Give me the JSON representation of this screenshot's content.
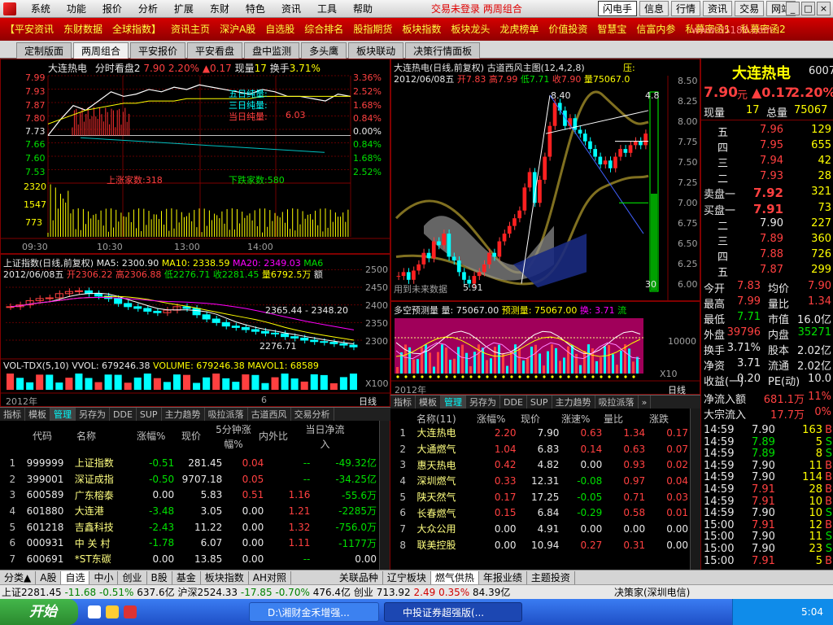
{
  "menu": {
    "items": [
      "系统",
      "功能",
      "报价",
      "分析",
      "扩展",
      "东财",
      "特色",
      "资讯",
      "工具",
      "帮助"
    ],
    "center": "交易未登录    两周组合"
  },
  "toolbar": {
    "items": [
      "闪电手",
      "信息",
      "行情",
      "资讯",
      "交易",
      "网站"
    ]
  },
  "redbar": {
    "items": [
      "【平安资讯",
      "东财数据",
      "全球指数】",
      "资讯主页",
      "深沪A股",
      "自选股",
      "综合排名",
      "股指期货",
      "板块指数",
      "板块龙头",
      "龙虎榜单",
      "价值投资",
      "智慧宝",
      "信富内参",
      "私募密函1",
      "私募密函2"
    ]
  },
  "tabs": {
    "items": [
      "定制版面",
      "两周组合",
      "平安报价",
      "平安看盘",
      "盘中监测",
      "多头鹰",
      "板块联动",
      "决策行情面板"
    ],
    "active": 1
  },
  "intraday": {
    "title": "大连热电",
    "mode": "分时看盘2",
    "price": "7.90",
    "pct": "2.20%",
    "chg": "▲0.17",
    "vol_label": "现量",
    "vol": "17",
    "turnover_label": "换手",
    "turnover": "3.71%",
    "left_axis": [
      "7.99",
      "7.93",
      "7.87",
      "7.80",
      "7.73",
      "7.66",
      "7.60",
      "7.53",
      "2320",
      "1547",
      "773"
    ],
    "right_axis": [
      "3.36%",
      "2.52%",
      "1.68%",
      "0.84%",
      "0.00%",
      "0.84%",
      "1.68%",
      "2.52%"
    ],
    "times": [
      "09:30",
      "10:30",
      "13:00",
      "14:00"
    ],
    "legend": [
      "五日纯量:",
      "三日纯量:",
      "当日纯量:"
    ],
    "legend_val": "6.03",
    "up_count": "上涨家数:318",
    "down_count": "下跌家数:580",
    "price_line": [
      7.73,
      7.8,
      7.86,
      7.84,
      7.88,
      7.92,
      7.9,
      7.91,
      7.93,
      7.92,
      7.94,
      7.93,
      7.95,
      7.94,
      7.93,
      7.92,
      7.91,
      7.93,
      7.92,
      7.9,
      7.9,
      7.89,
      7.88,
      7.91,
      7.9
    ],
    "avg_line": [
      7.78,
      7.8,
      7.82,
      7.84,
      7.85,
      7.86,
      7.87,
      7.87,
      7.88,
      7.88,
      7.88,
      7.89,
      7.89,
      7.89,
      7.89,
      7.89,
      7.89,
      7.9,
      7.9,
      7.9,
      7.9,
      7.9,
      7.9,
      7.9,
      7.9
    ]
  },
  "index": {
    "title": "上证指数(日线,前复权)",
    "ma5": "MA5: 2300.90",
    "ma10": "MA10: 2338.59",
    "ma20": "MA20: 2349.03",
    "ma6": "MA6",
    "date": "2012/06/08五",
    "open": "开2306.22",
    "high": "高2306.88",
    "low": "低2276.71",
    "close": "收2281.45",
    "amount": "量6792.5万",
    "amount_unit": "额",
    "axis": [
      "2500",
      "2450",
      "2400",
      "2350",
      "2300"
    ],
    "ann_high": "2365.44 - 2348.20",
    "ann_low": "2276.71",
    "closes": [
      2395,
      2400,
      2412,
      2418,
      2420,
      2432,
      2438,
      2440,
      2432,
      2425,
      2418,
      2404,
      2395,
      2390,
      2382,
      2378,
      2385,
      2395,
      2390,
      2372,
      2360,
      2350,
      2340,
      2336,
      2330,
      2325,
      2320,
      2318,
      2310,
      2306,
      2300,
      2296,
      2294,
      2290,
      2286,
      2281
    ]
  },
  "vol": {
    "title": "VOL-TDX(5,10)",
    "vvol": "VVOL: 679246.38",
    "volume": "VOLUME: 679246.38",
    "mavol": "MAVOL1: 68589",
    "unit": "X100",
    "year": "2012年",
    "month": "6",
    "period": "日线"
  },
  "kline": {
    "title": "大连热电(日线,前复权) 古道西风主图(12,4,2,8)",
    "extra": "压:",
    "date": "2012/06/08五",
    "open": "开7.83",
    "high": "高7.99",
    "low": "低7.71",
    "close": "收7.90",
    "amount": "量75067.0",
    "axis": [
      "8.50",
      "8.25",
      "8.00",
      "7.75",
      "7.50",
      "7.25",
      "7.00",
      "6.75",
      "6.50",
      "6.25",
      "6.00"
    ],
    "ann_high": "8.40",
    "ann_low": "5.91",
    "ann_right": "4.8",
    "ann_bottom": "30",
    "note": "用到未来数据",
    "closes": [
      6.05,
      6.1,
      6.0,
      6.12,
      6.2,
      6.35,
      6.28,
      6.5,
      6.45,
      6.6,
      6.3,
      6.25,
      6.1,
      6.0,
      5.95,
      6.05,
      6.1,
      6.2,
      6.35,
      6.3,
      6.5,
      6.6,
      6.7,
      6.8,
      6.9,
      7.2,
      7.4,
      7.0,
      7.3,
      7.6,
      8.0,
      8.3,
      8.2,
      8.0,
      8.1,
      7.95,
      7.9,
      7.8,
      7.7,
      7.6,
      7.5,
      7.55,
      7.45,
      7.6,
      7.7,
      7.65,
      7.75,
      7.8,
      7.75,
      7.9
    ]
  },
  "forecast": {
    "title": "多空预测量",
    "amount": "量: 75067.00",
    "pred": "预测量: 75067.00",
    "turnover": "换: 3.71",
    "flow": "流",
    "axis": "10000",
    "unit": "X10",
    "year": "2012年",
    "period": "日线"
  },
  "left_list": {
    "tabs": [
      "指标",
      "模板",
      "管理",
      "另存为",
      "DDE",
      "SUP",
      "主力趋势",
      "吸拉派落",
      "古道西风",
      "交易分析"
    ],
    "active": 2,
    "headers": [
      "代码",
      "名称",
      "涨幅%",
      "现价",
      "5分钟涨幅%",
      "内外比",
      "当日净流入"
    ],
    "rows": [
      [
        "1",
        "999999",
        "上证指数",
        "-0.51",
        "281.45",
        "0.04",
        "--",
        "-49.32亿"
      ],
      [
        "2",
        "399001",
        "深证成指",
        "-0.50",
        "9707.18",
        "0.05",
        "--",
        "-34.25亿"
      ],
      [
        "3",
        "600589",
        "广东榕泰",
        "0.00",
        "5.83",
        "0.51",
        "1.16",
        "-55.6万"
      ],
      [
        "4",
        "601880",
        "大连港",
        "-3.48",
        "3.05",
        "0.00",
        "1.21",
        "-2285万"
      ],
      [
        "5",
        "601218",
        "吉鑫科技",
        "-2.43",
        "11.22",
        "0.00",
        "1.32",
        "-756.0万"
      ],
      [
        "6",
        "000931",
        "中 关 村",
        "-1.78",
        "6.07",
        "0.00",
        "1.11",
        "-1177万"
      ],
      [
        "7",
        "600691",
        "*ST东碳",
        "0.00",
        "13.85",
        "0.00",
        "--",
        "0.00"
      ]
    ]
  },
  "right_list": {
    "tabs": [
      "指标",
      "模板",
      "管理",
      "另存为",
      "DDE",
      "SUP",
      "主力趋势",
      "吸拉派落"
    ],
    "active": 2,
    "headers": [
      "名称(11)",
      "涨幅%",
      "现价",
      "涨速%",
      "量比",
      "涨跌"
    ],
    "rows": [
      [
        "1",
        "大连热电",
        "2.20",
        "7.90",
        "0.63",
        "1.34",
        "0.17"
      ],
      [
        "2",
        "大通燃气",
        "1.04",
        "6.83",
        "0.14",
        "0.63",
        "0.07"
      ],
      [
        "3",
        "惠天热电",
        "0.42",
        "4.82",
        "0.00",
        "0.93",
        "0.02"
      ],
      [
        "4",
        "深圳燃气",
        "0.33",
        "12.31",
        "-0.08",
        "0.97",
        "0.04"
      ],
      [
        "5",
        "陕天然气",
        "0.17",
        "17.25",
        "-0.05",
        "0.71",
        "0.03"
      ],
      [
        "6",
        "长春燃气",
        "0.15",
        "6.84",
        "-0.29",
        "0.58",
        "0.01"
      ],
      [
        "7",
        "大众公用",
        "0.00",
        "4.91",
        "0.00",
        "0.00",
        "0.00"
      ],
      [
        "8",
        "联美控股",
        "0.00",
        "10.94",
        "0.27",
        "0.31",
        "0.00"
      ]
    ]
  },
  "quote": {
    "name": "大连热电",
    "code": "6007",
    "price": "7.90",
    "price_unit": "元",
    "chg": "▲0.17",
    "pct": "2.20%",
    "now_label": "现量",
    "now": "17",
    "total_label": "总量",
    "total": "75067",
    "sells": [
      [
        "五",
        "7.96",
        "129"
      ],
      [
        "四",
        "7.95",
        "655"
      ],
      [
        "三",
        "7.94",
        "42"
      ],
      [
        "二",
        "7.93",
        "28"
      ],
      [
        "卖盘一",
        "7.92",
        "321"
      ]
    ],
    "buys": [
      [
        "买盘一",
        "7.91",
        "73"
      ],
      [
        "二",
        "7.90",
        "227"
      ],
      [
        "三",
        "7.89",
        "360"
      ],
      [
        "四",
        "7.88",
        "726"
      ],
      [
        "五",
        "7.87",
        "299"
      ]
    ],
    "stats": [
      [
        "今开",
        "7.83",
        "均价",
        "7.90"
      ],
      [
        "最高",
        "7.99",
        "量比",
        "1.34"
      ],
      [
        "最低",
        "7.71",
        "市值",
        "16.0亿"
      ],
      [
        "外盘",
        "39796",
        "内盘",
        "35271"
      ],
      [
        "换手",
        "3.71%",
        "股本",
        "2.02亿"
      ],
      [
        "净资",
        "3.71",
        "流通",
        "2.02亿"
      ],
      [
        "收益(一)",
        "0.20",
        "PE(动)",
        "10.0"
      ]
    ],
    "flow": [
      [
        "净流入额",
        "681.1万",
        "11%"
      ],
      [
        "大宗流入",
        "17.7万",
        "0%"
      ]
    ],
    "ticks": [
      [
        "14:59",
        "7.90",
        "163",
        "B"
      ],
      [
        "14:59",
        "7.89",
        "5",
        "S"
      ],
      [
        "14:59",
        "7.89",
        "8",
        "S"
      ],
      [
        "14:59",
        "7.90",
        "11",
        "B"
      ],
      [
        "14:59",
        "7.90",
        "114",
        "B"
      ],
      [
        "14:59",
        "7.91",
        "28",
        "B"
      ],
      [
        "14:59",
        "7.91",
        "10",
        "B"
      ],
      [
        "14:59",
        "7.90",
        "10",
        "S"
      ],
      [
        "15:00",
        "7.91",
        "12",
        "B"
      ],
      [
        "15:00",
        "7.90",
        "11",
        "S"
      ],
      [
        "15:00",
        "7.90",
        "23",
        "S"
      ],
      [
        "15:00",
        "7.91",
        "5",
        "B"
      ]
    ]
  },
  "left_btabs": [
    "分类▲",
    "A股",
    "自选",
    "中小",
    "创业",
    "B股",
    "基金",
    "板块指数",
    "AH对照"
  ],
  "right_btabs": [
    "关联品种",
    "辽宁板块",
    "燃气供热",
    "年报业绩",
    "主题投资"
  ],
  "status": {
    "sh": "上证2281.45",
    "sh_chg": "-11.68",
    "sh_pct": "-0.51%",
    "sh_amt": "637.6亿",
    "sz": "沪深2524.33",
    "sz_chg": "-17.85",
    "sz_pct": "-0.70%",
    "sz_amt": "476.4亿",
    "cy": "创业 713.92",
    "cy_chg": "2.49",
    "cy_pct": "0.35%",
    "cy_amt": "84.39亿",
    "right": "决策家(深圳电信)"
  },
  "taskbar": {
    "start": "开始",
    "task1": "D:\\湘财金禾增强...",
    "task2": "中投证券超强版(...",
    "time": "5:04"
  },
  "site": "www.55188.com"
}
